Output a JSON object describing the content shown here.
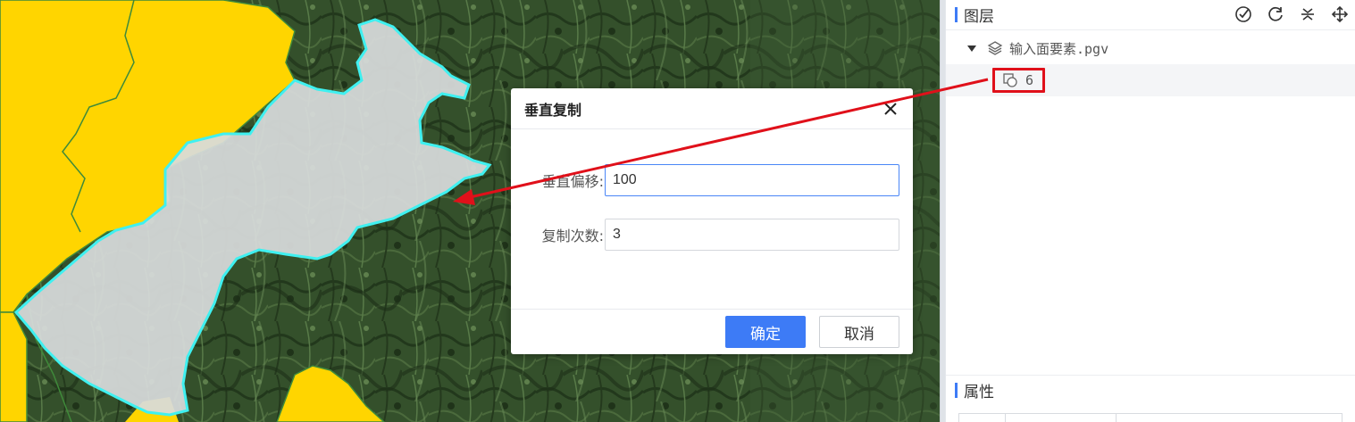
{
  "panel": {
    "layers_title": "图层",
    "props_title": "属性",
    "tree": {
      "parent_label": "输入面要素.pgv",
      "child_label": "6"
    },
    "tools": [
      "check-circle-icon",
      "refresh-icon",
      "split-icon",
      "move-icon"
    ]
  },
  "dialog": {
    "title": "垂直复制",
    "fields": {
      "offset_label": "垂直偏移:",
      "offset_value": "100",
      "count_label": "复制次数:",
      "count_value": "3"
    },
    "ok_label": "确定",
    "cancel_label": "取消"
  },
  "colors": {
    "accent": "#3d7bf6",
    "highlight_box": "#e0101a",
    "region_fill": "#d8dcdc",
    "region_outline": "#3ff0f0",
    "yellow_region": "#ffd500"
  }
}
